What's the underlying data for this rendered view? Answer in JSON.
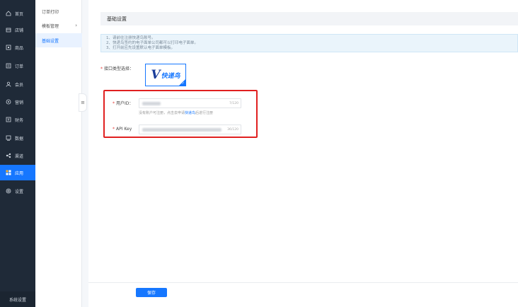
{
  "sidebar": {
    "items": [
      {
        "label": "首页",
        "icon": "home-icon"
      },
      {
        "label": "店铺",
        "icon": "store-icon"
      },
      {
        "label": "商品",
        "icon": "goods-icon"
      },
      {
        "label": "订单",
        "icon": "order-icon"
      },
      {
        "label": "会员",
        "icon": "member-icon"
      },
      {
        "label": "营销",
        "icon": "marketing-icon"
      },
      {
        "label": "财务",
        "icon": "finance-icon"
      },
      {
        "label": "数据",
        "icon": "data-icon"
      },
      {
        "label": "渠道",
        "icon": "channel-icon"
      },
      {
        "label": "应用",
        "icon": "apps-icon",
        "active": true
      },
      {
        "label": "设置",
        "icon": "settings-icon"
      }
    ],
    "footer": "系统设置"
  },
  "subnav": {
    "items": [
      {
        "label": "订单打印"
      },
      {
        "label": "模板管理"
      },
      {
        "label": "基础设置",
        "active": true
      }
    ]
  },
  "main": {
    "header_title": "基础设置",
    "notice_lines": [
      "1、请前往注册快递鸟账号。",
      "2、快递鸟签约的电子面单公司都可以打印电子面单。",
      "3、打开前应先设置默认电子面单模板。"
    ],
    "interface_label": "接口类型选择：",
    "logo": {
      "mark": "V",
      "text": "快递鸟"
    },
    "user_id": {
      "label": "用户ID：",
      "counter": "7/120"
    },
    "user_id_hint": {
      "prefix": "没有账户可注册，点击去申请",
      "link": "快递鸟",
      "suffix": "后进行注册"
    },
    "api_key": {
      "label": "API Key",
      "counter": "36/120"
    },
    "save_label": "保存"
  },
  "colors": {
    "accent": "#1677ff",
    "sidebar_bg": "#1f2a38",
    "highlight_border": "#e02020"
  }
}
